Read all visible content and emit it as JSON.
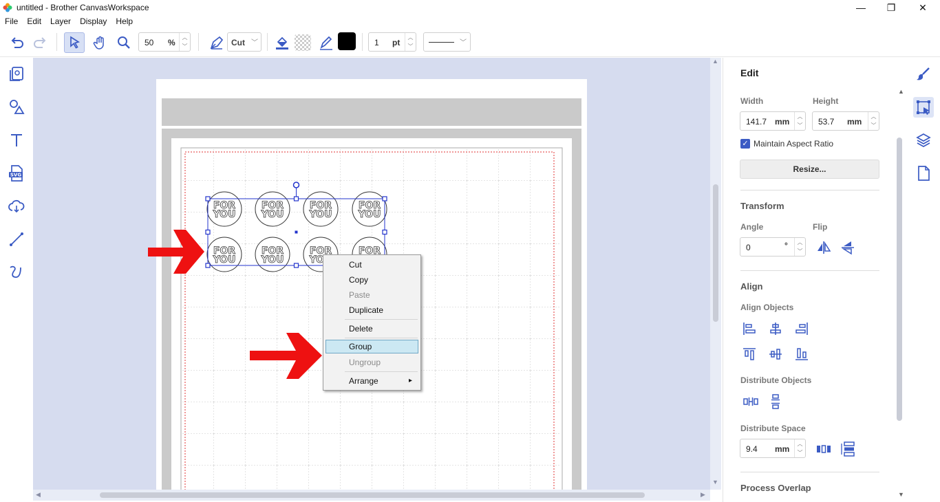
{
  "window": {
    "title": "untitled - Brother CanvasWorkspace",
    "minimize_label": "—",
    "restore_label": "❐",
    "close_label": "✕"
  },
  "menu": [
    "File",
    "Edit",
    "Layer",
    "Display",
    "Help"
  ],
  "toolbar": {
    "zoom_value": "50",
    "zoom_unit": "%",
    "mode_label": "Cut",
    "line_width_value": "1",
    "line_width_unit": "pt",
    "line_color": "#000000",
    "icons": [
      "undo-icon",
      "redo-icon",
      "select-icon",
      "hand-icon",
      "zoom-icon",
      "pen-mode-icon",
      "fill-icon",
      "transparency-icon",
      "line-color-pen-icon"
    ]
  },
  "left_tools": [
    "pages-icon",
    "shapes-icon",
    "text-icon",
    "svg-icon",
    "cloud-icon",
    "line-icon",
    "freehand-icon"
  ],
  "canvas": {
    "object_text_line1": "FOR",
    "object_text_line2": "YOU",
    "object_count": 8
  },
  "context_menu": {
    "items": [
      {
        "label": "Cut",
        "enabled": true
      },
      {
        "label": "Copy",
        "enabled": true
      },
      {
        "label": "Paste",
        "enabled": false
      },
      {
        "label": "Duplicate",
        "enabled": true
      },
      {
        "label": "Delete",
        "enabled": true
      },
      {
        "label": "Group",
        "enabled": true,
        "highlighted": true
      },
      {
        "label": "Ungroup",
        "enabled": false
      },
      {
        "label": "Arrange",
        "enabled": true,
        "submenu": true
      }
    ],
    "submenu_arrow": "▸"
  },
  "edit_panel": {
    "title": "Edit",
    "width_label": "Width",
    "width_value": "141.7",
    "width_unit": "mm",
    "height_label": "Height",
    "height_value": "53.7",
    "height_unit": "mm",
    "maintain_aspect_label": "Maintain Aspect Ratio",
    "maintain_aspect_checked": true,
    "resize_label": "Resize...",
    "transform_label": "Transform",
    "angle_label": "Angle",
    "angle_value": "0",
    "angle_unit": "°",
    "flip_label": "Flip",
    "align_label": "Align",
    "align_objects_label": "Align Objects",
    "distribute_objects_label": "Distribute Objects",
    "distribute_space_label": "Distribute Space",
    "distribute_space_value": "9.4",
    "distribute_space_unit": "mm",
    "process_overlap_label": "Process Overlap"
  },
  "right_tabs": [
    "paint-brush-icon",
    "edit-transform-icon",
    "layers-icon",
    "page-icon"
  ],
  "colors": {
    "accent": "#3b5bc4",
    "highlight": "#cce8f3",
    "canvas_bg": "#d6dcef",
    "arrow": "#ee1111"
  }
}
